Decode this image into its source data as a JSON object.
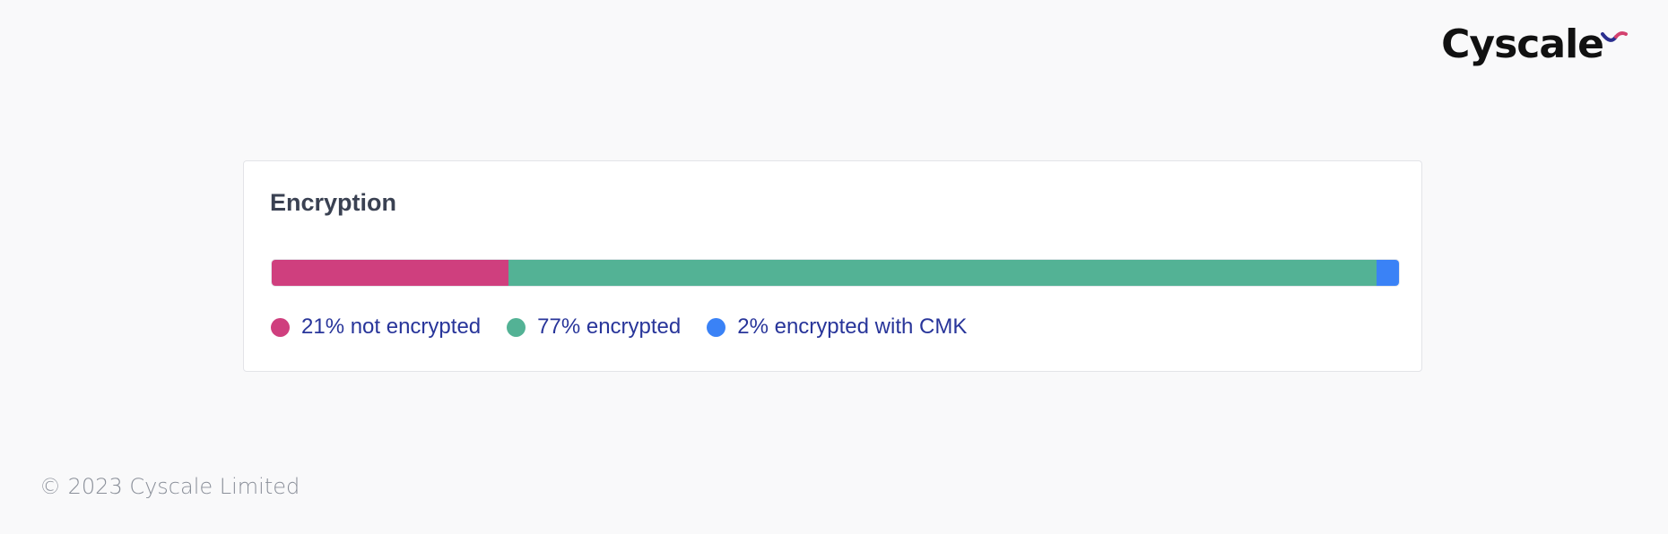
{
  "brand": {
    "name": "Cyscale",
    "mark_icon": "swoosh-logo-mark",
    "mark_colors": [
      "#2b2f8f",
      "#d4426f"
    ]
  },
  "card": {
    "title": "Encryption",
    "segments": [
      {
        "key": "not_encrypted",
        "value": 0.21,
        "color": "#cf3f7e",
        "label": "21% not encrypted"
      },
      {
        "key": "encrypted",
        "value": 0.77,
        "color": "#53b295",
        "label": "77% encrypted"
      },
      {
        "key": "encrypted_cmk",
        "value": 0.02,
        "color": "#3a82f6",
        "label": "2% encrypted with CMK"
      }
    ]
  },
  "footer": {
    "text": "© 2023 Cyscale Limited"
  }
}
